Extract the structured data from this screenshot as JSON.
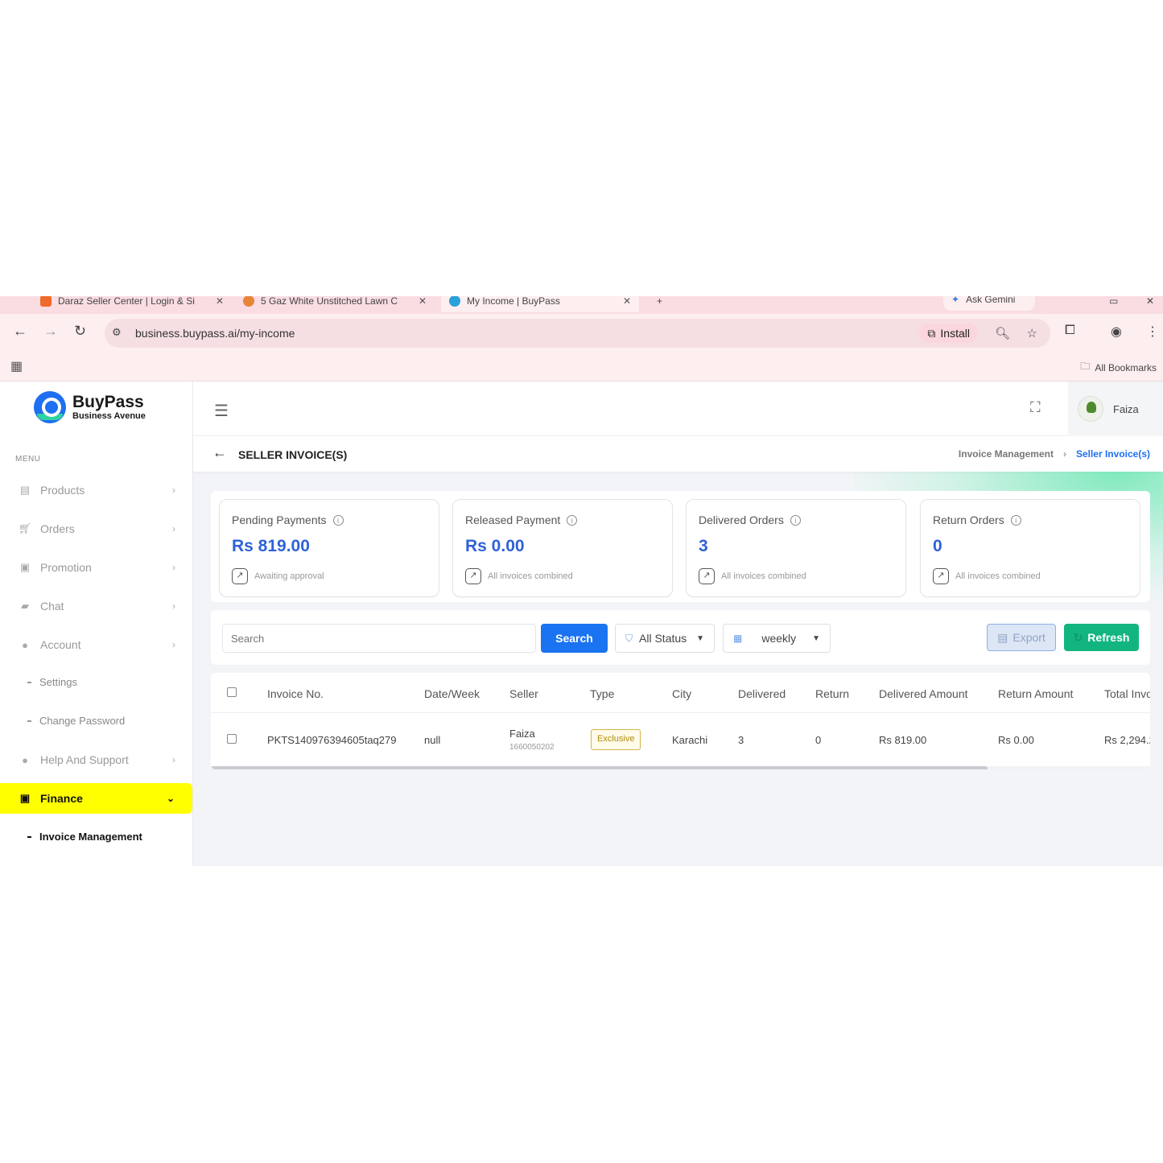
{
  "browser": {
    "tabs": [
      {
        "title": "Daraz Seller Center | Login & Si"
      },
      {
        "title": "5 Gaz White Unstitched Lawn C"
      },
      {
        "title": "My Income | BuyPass"
      }
    ],
    "new_tab": "+",
    "gemini": "Ask Gemini",
    "url": "business.buypass.ai/my-income",
    "install": "Install",
    "all_bookmarks": "All Bookmarks"
  },
  "brand": {
    "name": "BuyPass",
    "tagline": "Business Avenue"
  },
  "sidebar": {
    "menu_label": "MENU",
    "items": [
      {
        "label": "Products",
        "icon": "products-icon"
      },
      {
        "label": "Orders",
        "icon": "cart-icon"
      },
      {
        "label": "Promotion",
        "icon": "ticket-icon"
      },
      {
        "label": "Chat",
        "icon": "chat-icon"
      },
      {
        "label": "Account",
        "icon": "user-icon"
      }
    ],
    "account_sub": [
      "Settings",
      "Change Password"
    ],
    "help": "Help And Support",
    "finance": "Finance",
    "finance_sub": "Invoice Management"
  },
  "topbar": {
    "user_name": "Faiza"
  },
  "page": {
    "title": "SELLER INVOICE(S)",
    "breadcrumb_parent": "Invoice Management",
    "breadcrumb_current": "Seller Invoice(s)"
  },
  "cards": [
    {
      "label": "Pending Payments",
      "value": "Rs 819.00",
      "sub": "Awaiting approval"
    },
    {
      "label": "Released Payment",
      "value": "Rs 0.00",
      "sub": "All invoices combined"
    },
    {
      "label": "Delivered Orders",
      "value": "3",
      "sub": "All invoices combined"
    },
    {
      "label": "Return Orders",
      "value": "0",
      "sub": "All invoices combined"
    }
  ],
  "filters": {
    "search_placeholder": "Search",
    "search_button": "Search",
    "status_value": "All Status",
    "period_value": "weekly",
    "export": "Export",
    "refresh": "Refresh"
  },
  "table": {
    "headers": [
      "Invoice No.",
      "Date/Week",
      "Seller",
      "Type",
      "City",
      "Delivered",
      "Return",
      "Delivered Amount",
      "Return Amount",
      "Total Invo"
    ],
    "rows": [
      {
        "invoice_no": "PKTS140976394605taq279",
        "date_week": "null",
        "seller_name": "Faiza",
        "seller_id": "1660050202",
        "type": "Exclusive",
        "city": "Karachi",
        "delivered": "3",
        "return": "0",
        "delivered_amount": "Rs 819.00",
        "return_amount": "Rs 0.00",
        "total": "Rs 2,294.2"
      }
    ]
  },
  "colors": {
    "primary": "#1a73f0",
    "success": "#12b580",
    "highlight": "#ffff00",
    "value_blue": "#2f62d8"
  }
}
